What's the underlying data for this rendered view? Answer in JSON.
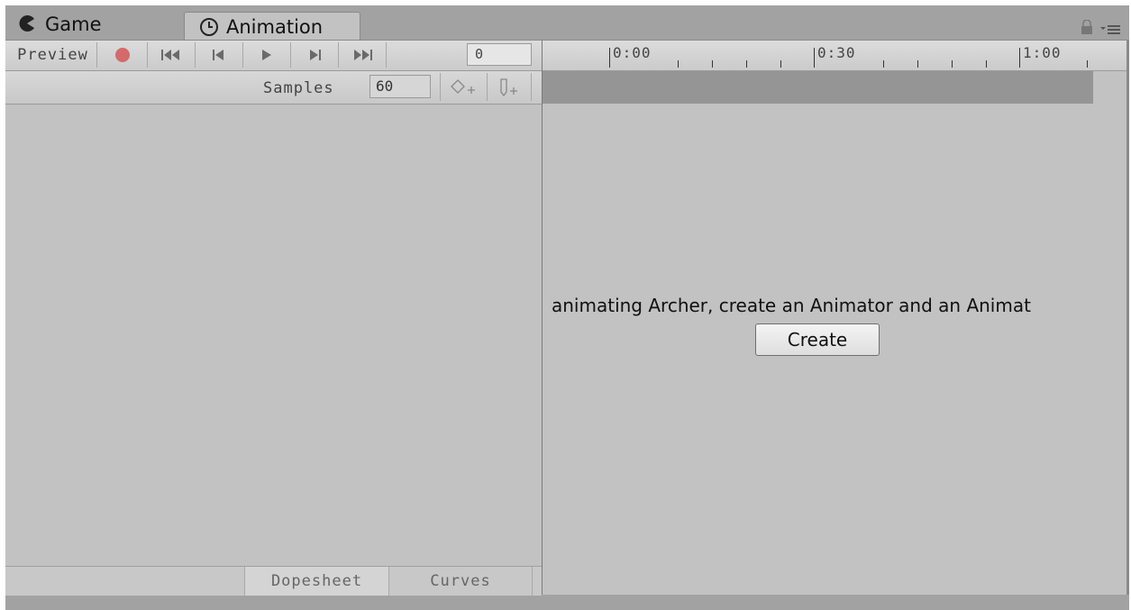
{
  "tabs": [
    {
      "label": "Game",
      "icon": "pacman-icon",
      "active": false
    },
    {
      "label": "Animation",
      "icon": "clock-icon",
      "active": true
    }
  ],
  "toolbar": {
    "preview_label": "Preview",
    "record_icon": "record-icon",
    "first_key_icon": "first-keyframe-icon",
    "prev_key_icon": "previous-keyframe-icon",
    "play_icon": "play-icon",
    "next_key_icon": "next-keyframe-icon",
    "last_key_icon": "last-keyframe-icon",
    "frame_value": "0"
  },
  "samples": {
    "label": "Samples",
    "value": "60",
    "add_keyframe_icon": "add-keyframe-icon",
    "add_event_icon": "add-event-icon"
  },
  "bottom_tabs": {
    "dopesheet": "Dopesheet",
    "curves": "Curves"
  },
  "timeline": {
    "labels": [
      "0:00",
      "0:30",
      "1:00"
    ]
  },
  "message": "animating Archer, create an Animator and an Animat",
  "create_label": "Create",
  "colors": {
    "record": "#d46a6a",
    "panel": "#c2c2c2",
    "chrome": "#a2a2a2"
  }
}
